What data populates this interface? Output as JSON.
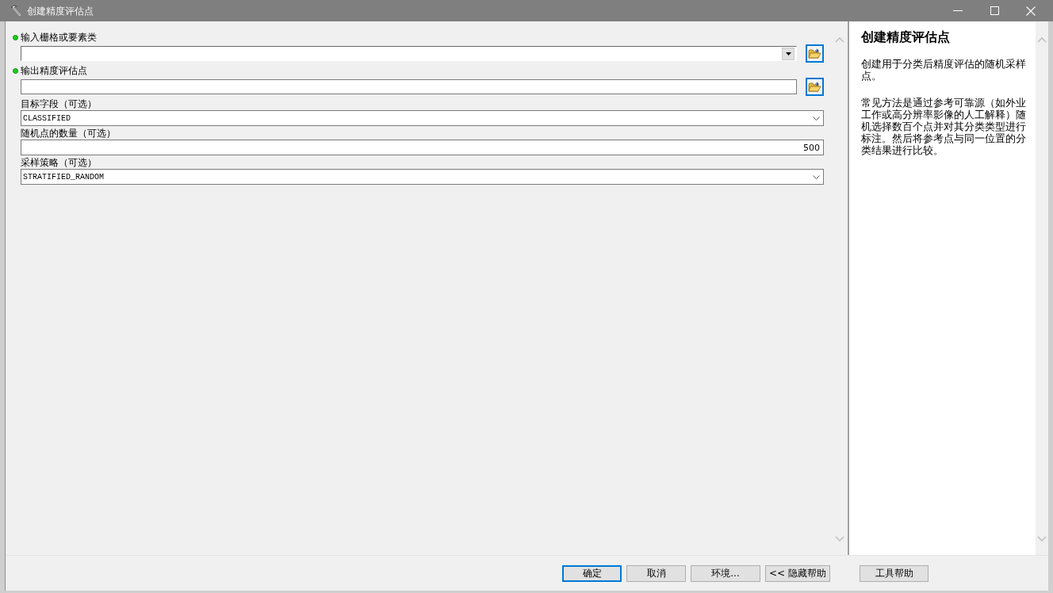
{
  "window": {
    "title": "创建精度评估点"
  },
  "parameters": [
    {
      "kind": "combo-browse",
      "label": "输入栅格或要素类",
      "required": true
    },
    {
      "kind": "text-browse",
      "label": "输出精度评估点",
      "required": true
    },
    {
      "kind": "select",
      "label": "目标字段（可选）",
      "required": false,
      "value": "CLASSIFIED"
    },
    {
      "kind": "number",
      "label": "随机点的数量（可选）",
      "required": false,
      "value": "500"
    },
    {
      "kind": "select",
      "label": "采样策略（可选）",
      "required": false,
      "value": "STRATIFIED_RANDOM"
    }
  ],
  "help": {
    "title": "创建精度评估点",
    "paragraphs": [
      "创建用于分类后精度评估的随机采样点。",
      "常见方法是通过参考可靠源（如外业工作或高分辨率影像的人工解释）随机选择数百个点并对其分类类型进行标注。然后将参考点与同一位置的分类结果进行比较。"
    ]
  },
  "buttons": [
    {
      "label": "确定",
      "default": true
    },
    {
      "label": "取消",
      "default": false
    },
    {
      "label": "环境...",
      "default": false
    },
    {
      "label": "<< 隐藏帮助",
      "default": false
    },
    {
      "label": "工具帮助",
      "default": false
    }
  ]
}
